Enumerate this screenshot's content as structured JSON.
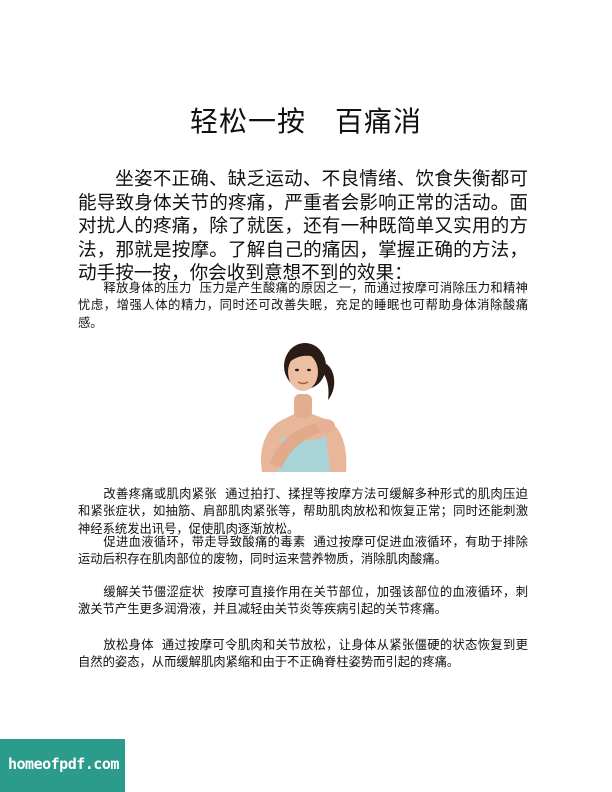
{
  "title": "轻松一按　百痛消",
  "intro": "坐姿不正确、缺乏运动、不良情绪、饮食失衡都可能导致身体关节的疼痛，严重者会影响正常的活动。面对扰人的疼痛，除了就医，还有一种既简单又实用的方法，那就是按摩。了解自己的痛因，掌握正确的方法，动手按一按，你会收到意想不到的效果：",
  "paragraphs": [
    {
      "lead": "释放身体的压力",
      "body": "压力是产生酸痛的原因之一，而通过按摩可消除压力和精神忧虑，增强人体的精力，同时还可改善失眠，充足的睡眠也可帮助身体消除酸痛感。"
    },
    {
      "lead": "改善疼痛或肌肉紧张",
      "body": "通过拍打、揉捏等按摩方法可缓解多种形式的肌肉压迫和紧张症状，如抽筋、肩部肌肉紧张等，帮助肌肉放松和恢复正常；同时还能刺激神经系统发出讯号，促使肌肉逐渐放松。"
    },
    {
      "lead": "促进血液循环，带走导致酸痛的毒素",
      "body": "通过按摩可促进血液循环，有助于排除运动后积存在肌肉部位的废物，同时运来营养物质，消除肌肉酸痛。"
    },
    {
      "lead": "缓解关节僵涩症状",
      "body": "按摩可直接作用在关节部位，加强该部位的血液循环，刺激关节产生更多润滑液，并且减轻由关节炎等疾病引起的关节疼痛。"
    },
    {
      "lead": "放松身体",
      "body": "通过按摩可令肌肉和关节放松，让身体从紧张僵硬的状态恢复到更自然的姿态，从而缓解肌肉紧缩和由于不正确脊柱姿势而引起的疼痛。"
    }
  ],
  "watermark": "homeofpdf.com",
  "colors": {
    "watermark_bg": "#2b9b8c",
    "top_color": "#a8d4d8"
  }
}
